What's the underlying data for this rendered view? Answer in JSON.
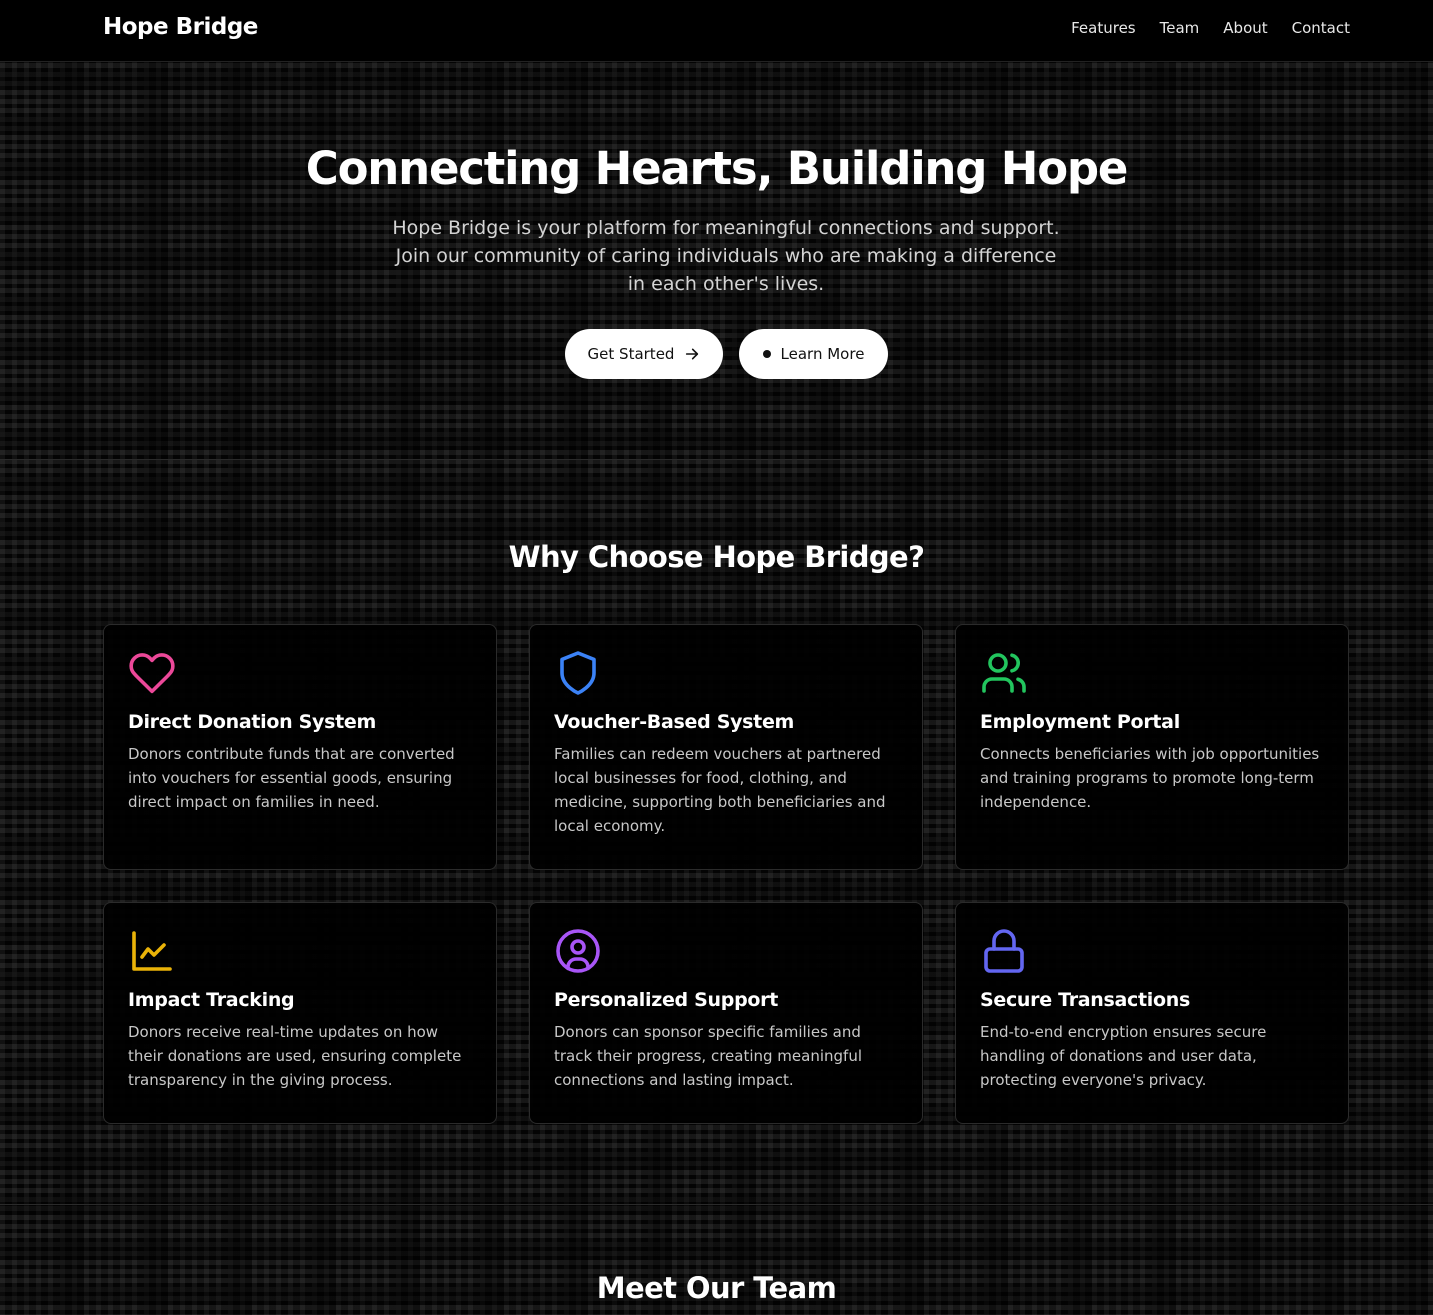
{
  "nav": {
    "brand": "Hope Bridge",
    "links": [
      "Features",
      "Team",
      "About",
      "Contact"
    ]
  },
  "hero": {
    "title": "Connecting Hearts, Building Hope",
    "subtitle": "Hope Bridge is your platform for meaningful connections and support. Join our community of caring individuals who are making a difference in each other's lives.",
    "primary_button": "Get Started",
    "secondary_button": "Learn More",
    "primary_icon": "arrow-right-icon",
    "secondary_icon": "dot-icon"
  },
  "features": {
    "title": "Why Choose Hope Bridge?",
    "cards": [
      {
        "icon": "heart-icon",
        "color": "#ec4899",
        "title": "Direct Donation System",
        "description": "Donors contribute funds that are converted into vouchers for essential goods, ensuring direct impact on families in need."
      },
      {
        "icon": "shield-icon",
        "color": "#3b82f6",
        "title": "Voucher-Based System",
        "description": "Families can redeem vouchers at partnered local businesses for food, clothing, and medicine, supporting both beneficiaries and local economy."
      },
      {
        "icon": "users-icon",
        "color": "#22c55e",
        "title": "Employment Portal",
        "description": "Connects beneficiaries with job opportunities and training programs to promote long-term independence."
      },
      {
        "icon": "line-chart-icon",
        "color": "#eab308",
        "title": "Impact Tracking",
        "description": "Donors receive real-time updates on how their donations are used, ensuring complete transparency in the giving process."
      },
      {
        "icon": "user-circle-icon",
        "color": "#a855f7",
        "title": "Personalized Support",
        "description": "Donors can sponsor specific families and track their progress, creating meaningful connections and lasting impact."
      },
      {
        "icon": "lock-icon",
        "color": "#6366f1",
        "title": "Secure Transactions",
        "description": "End-to-end encryption ensures secure handling of donations and user data, protecting everyone's privacy."
      }
    ]
  },
  "team": {
    "title": "Meet Our Team"
  }
}
